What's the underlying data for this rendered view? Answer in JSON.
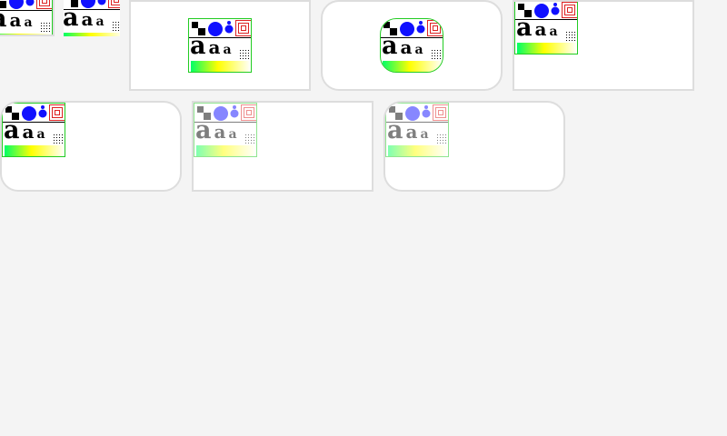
{
  "sample": {
    "glyph": "a"
  },
  "colors": {
    "page_background": "#f4f4f4",
    "frame_border": "#dddddd",
    "tile_border": "#22cc22",
    "dot_blue": "#1010ff",
    "target_red": "#dd2222",
    "gradient": [
      "#00ff66",
      "#ffff00",
      "#ffffff"
    ]
  },
  "icons": [
    "checker-squares-icon",
    "blue-dots-icon",
    "concentric-squares-icon",
    "dotted-grid-icon",
    "gradient-bar"
  ]
}
